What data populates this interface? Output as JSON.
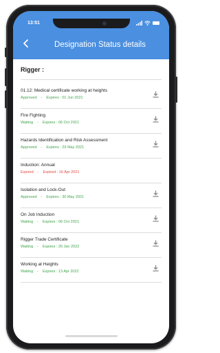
{
  "status_bar": {
    "time": "13:51"
  },
  "header": {
    "title": "Designation Status details"
  },
  "section": {
    "title": "Rigger :"
  },
  "items": [
    {
      "name": "01.12: Medical certificate working at heights",
      "status": "Approved",
      "sep": "-",
      "expires": "Expires : 01 Jun 2021",
      "downloadable": true
    },
    {
      "name": "Fire Fighting",
      "status": "Waiting",
      "sep": "-",
      "expires": "Expires : 06 Oct 2021",
      "downloadable": true
    },
    {
      "name": "Hazards Identification and Risk Assessment",
      "status": "Approved",
      "sep": "-",
      "expires": "Expires : 29 May 2021",
      "downloadable": true
    },
    {
      "name": "Induction: Annual",
      "status": "Expired",
      "sep": "-",
      "expires": "Expired : 16 Apr 2021",
      "downloadable": false
    },
    {
      "name": "Isolation and Lock-Out",
      "status": "Approved",
      "sep": "-",
      "expires": "Expires : 30 May 2021",
      "downloadable": true
    },
    {
      "name": "On Job Induction",
      "status": "Waiting",
      "sep": "-",
      "expires": "Expires : 06 Oct 2021",
      "downloadable": true
    },
    {
      "name": "Rigger Trade Certificate",
      "status": "Waiting",
      "sep": "-",
      "expires": "Expires : 26 Jan 2022",
      "downloadable": true
    },
    {
      "name": "Working at Heights",
      "status": "Waiting",
      "sep": "-",
      "expires": "Expires : 13 Apr 2022",
      "downloadable": true
    }
  ],
  "colors": {
    "header": "#4a8fe0",
    "status_ok": "#3ea54a",
    "status_expired": "#e24a3e"
  }
}
